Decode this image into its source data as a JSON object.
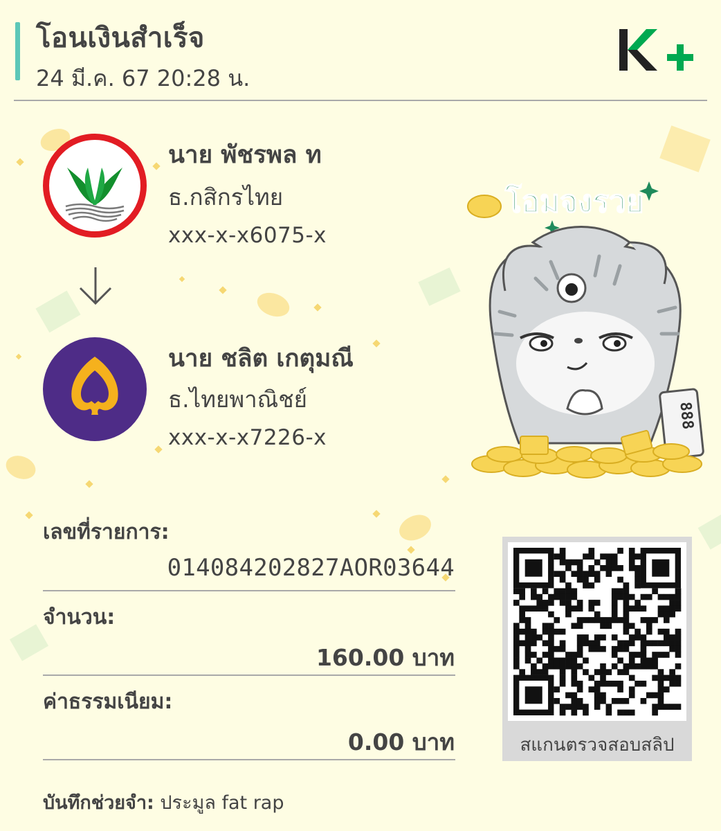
{
  "header": {
    "title": "โอนเงินสำเร็จ",
    "datetime": "24 มี.ค. 67  20:28 น.",
    "logo_name": "K+",
    "colors": {
      "accent_bar": "#5CC7B8",
      "logo_dark": "#222222",
      "logo_green": "#00A950"
    }
  },
  "sender": {
    "name": "นาย พัชรพล ท",
    "bank": "ธ.กสิกรไทย",
    "account": "xxx-x-x6075-x",
    "logo_icon": "kbank-logo",
    "colors": {
      "ring": "#E21C23",
      "leaf": "#138F2D"
    }
  },
  "receiver": {
    "name": "นาย ชลิต เกตุมณี",
    "bank": "ธ.ไทยพาณิชย์",
    "account": "xxx-x-x7226-x",
    "logo_icon": "scb-logo",
    "colors": {
      "background": "#4E2C87",
      "mark": "#F5B11D"
    }
  },
  "sticker": {
    "text": "โอมจงรวย",
    "plaque": "888",
    "icon": "cat-sticker-icon"
  },
  "details": {
    "ref_label": "เลขที่รายการ:",
    "ref_value": "014084202827AOR03644",
    "amount_label": "จำนวน:",
    "amount_value": "160.00 บาท",
    "fee_label": "ค่าธรรมเนียม:",
    "fee_value": "0.00 บาท"
  },
  "memo": {
    "label": "บันทึกช่วยจำ:",
    "value": "ประมูล fat rap"
  },
  "qr": {
    "caption": "สแกนตรวจสอบสลิป",
    "icon": "qr-code-icon"
  },
  "theme": {
    "background": "#FEFDE3",
    "text": "#444444",
    "rule": "#A9A9A9",
    "sticker_text": "#1F8A5B"
  }
}
